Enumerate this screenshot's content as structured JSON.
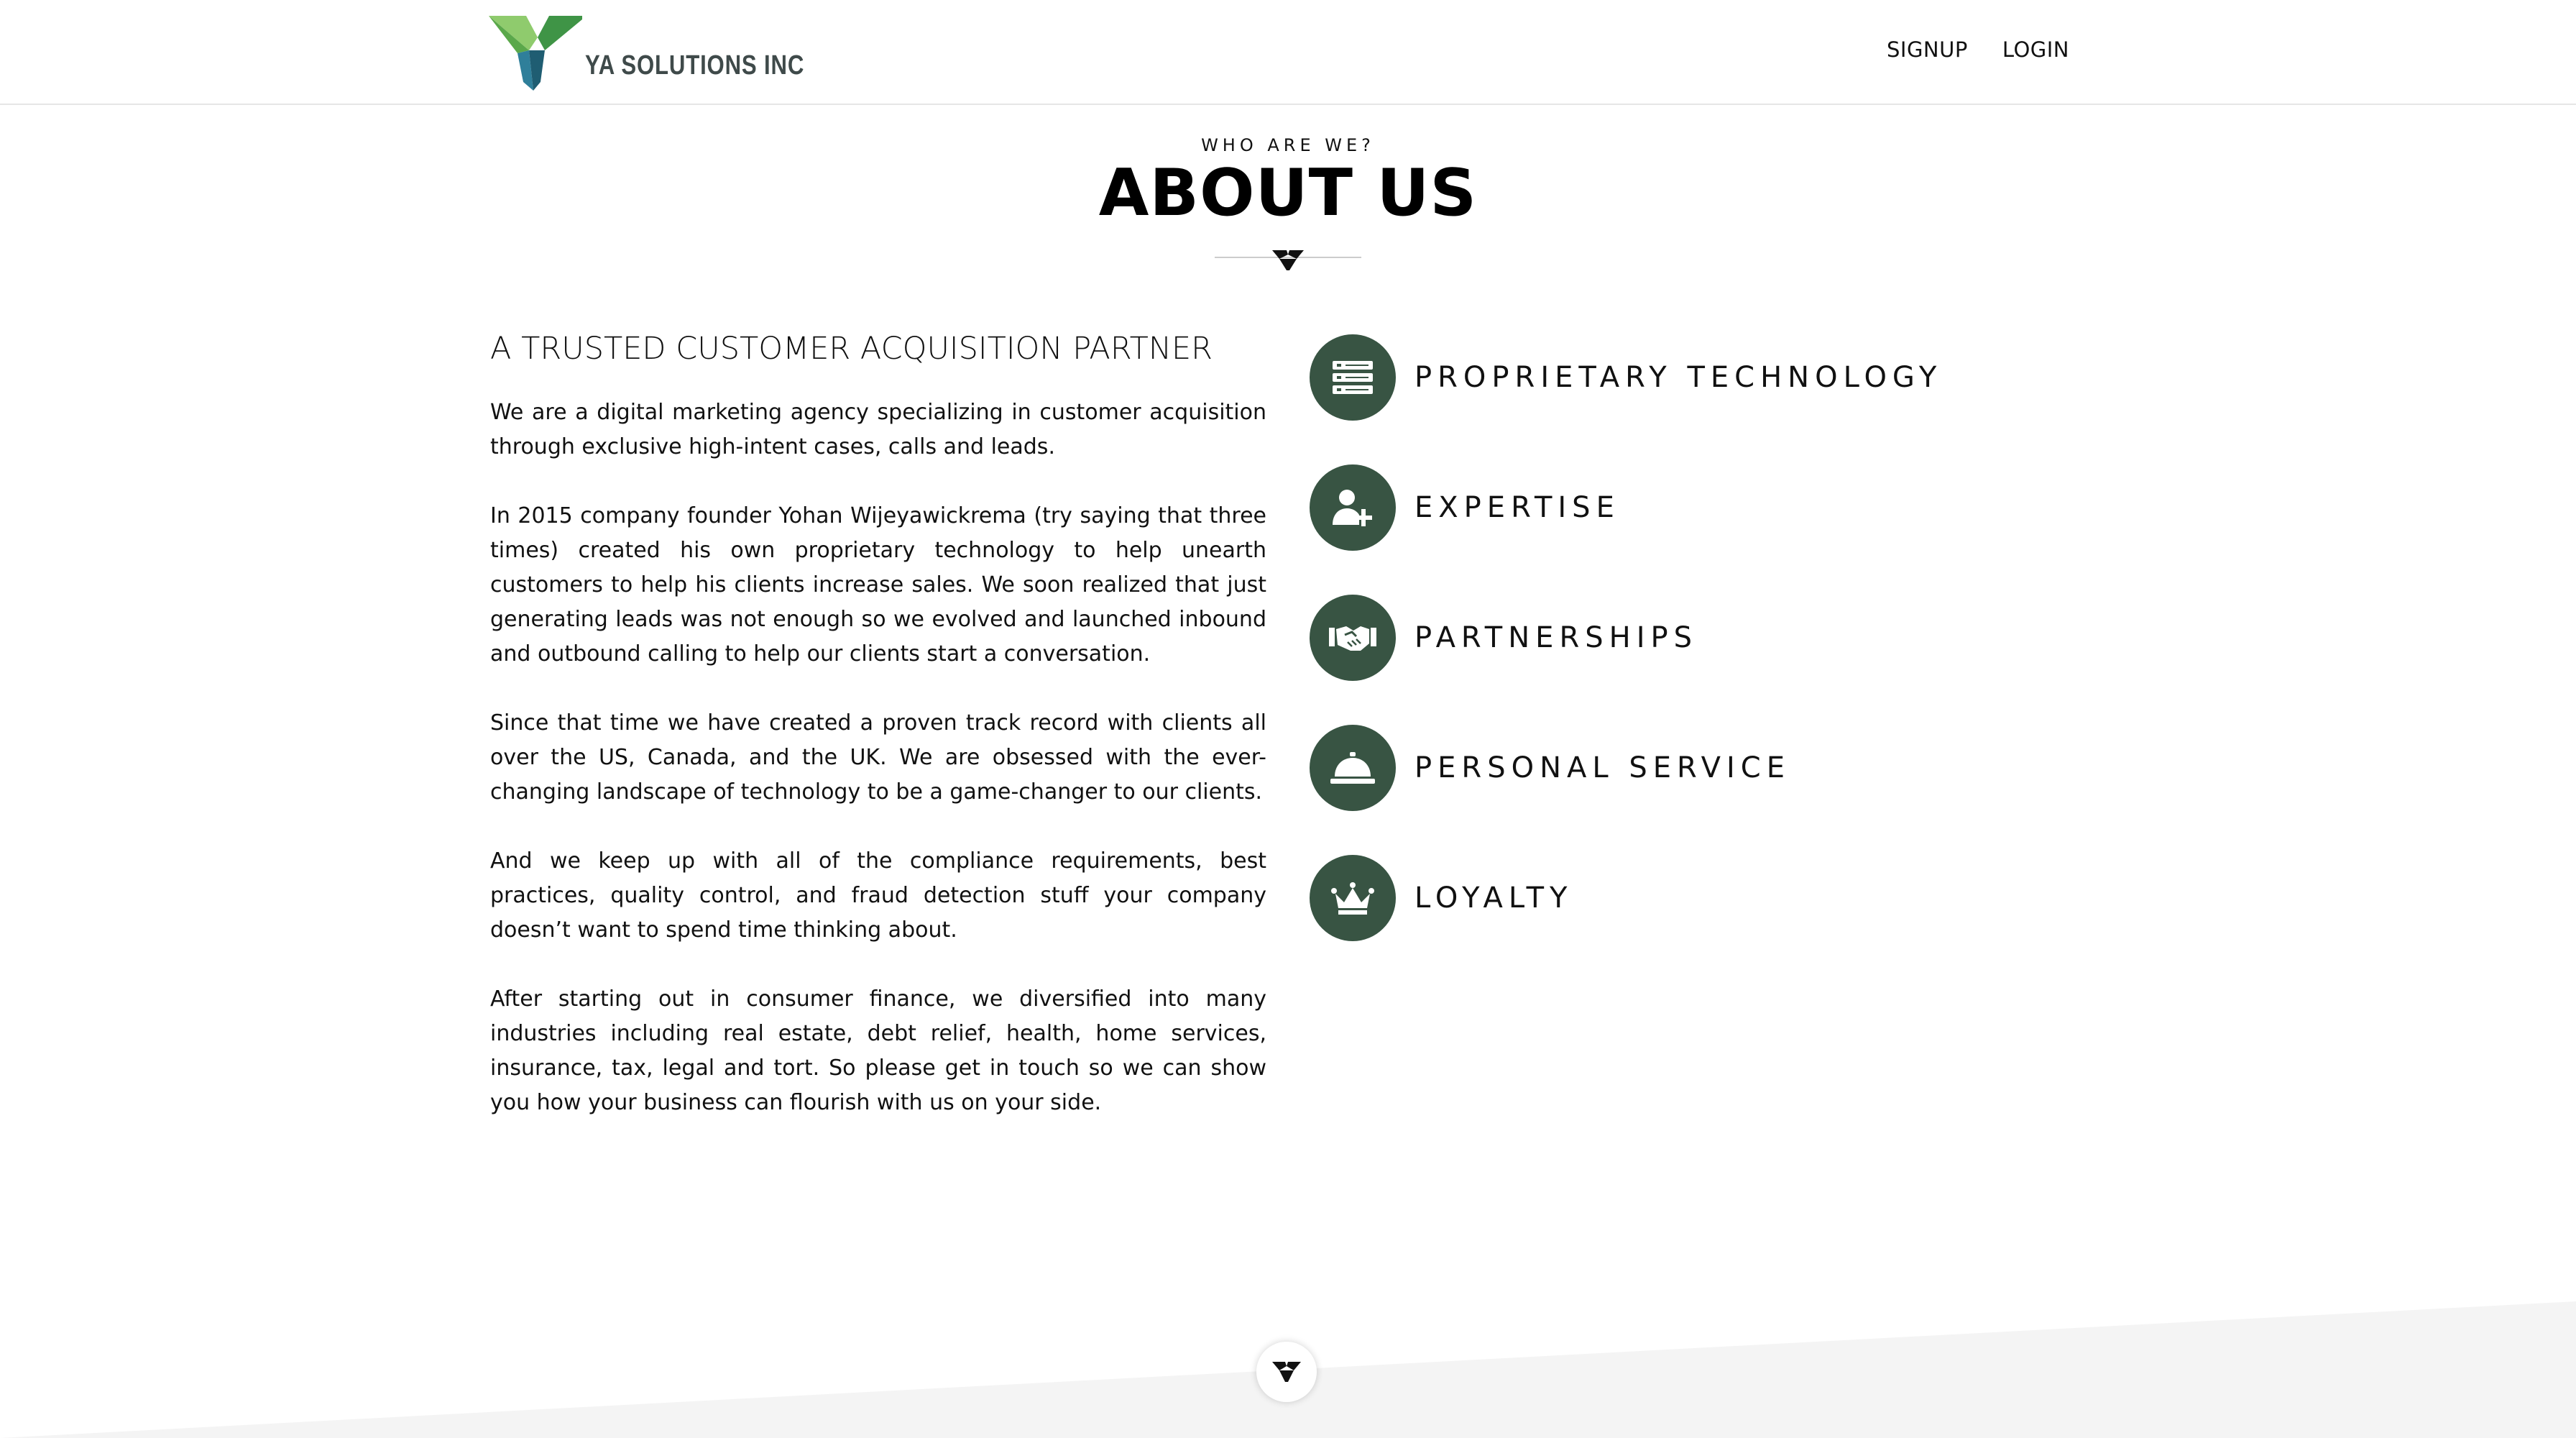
{
  "header": {
    "logo_text": "YA SOLUTIONS INC",
    "nav": [
      {
        "label": "SIGNUP"
      },
      {
        "label": "LOGIN"
      }
    ]
  },
  "section": {
    "eyebrow": "WHO ARE WE?",
    "title": "ABOUT US"
  },
  "about": {
    "subheading": "A TRUSTED CUSTOMER ACQUISITION PARTNER",
    "paragraphs": [
      "We are a digital marketing agency specializing in customer acquisition through exclusive high-intent cases, calls and leads.",
      "In 2015 company founder Yohan Wijeyawickrema (try saying that three times) created his own proprietary technology to help unearth customers to help his clients increase sales. We soon realized that just generating leads was not enough so we evolved and launched inbound and outbound calling to help our clients start a conversation.",
      "Since that time we have created a proven track record with clients all over the US, Canada, and the UK. We are obsessed with the ever-changing landscape of technology to be a game-changer to our clients.",
      "And we keep up with all of the compliance requirements, best practices, quality control, and fraud detection stuff your company doesn’t want to spend time thinking about.",
      "After starting out in consumer finance, we diversified into many industries including real estate, debt relief, health, home services, insurance, tax, legal and tort. So please get in touch so we can show you how your business can flourish with us on your side."
    ]
  },
  "features": [
    {
      "label": "PROPRIETARY TECHNOLOGY",
      "icon": "server-icon"
    },
    {
      "label": "EXPERTISE",
      "icon": "user-plus-icon"
    },
    {
      "label": "PARTNERSHIPS",
      "icon": "handshake-icon"
    },
    {
      "label": "PERSONAL SERVICE",
      "icon": "service-bell-icon"
    },
    {
      "label": "LOYALTY",
      "icon": "crown-icon"
    }
  ],
  "colors": {
    "accent": "#385443",
    "logo_green": "#5aa84a",
    "logo_blue": "#2f7f9a",
    "footer_bg": "#f4f4f4"
  }
}
